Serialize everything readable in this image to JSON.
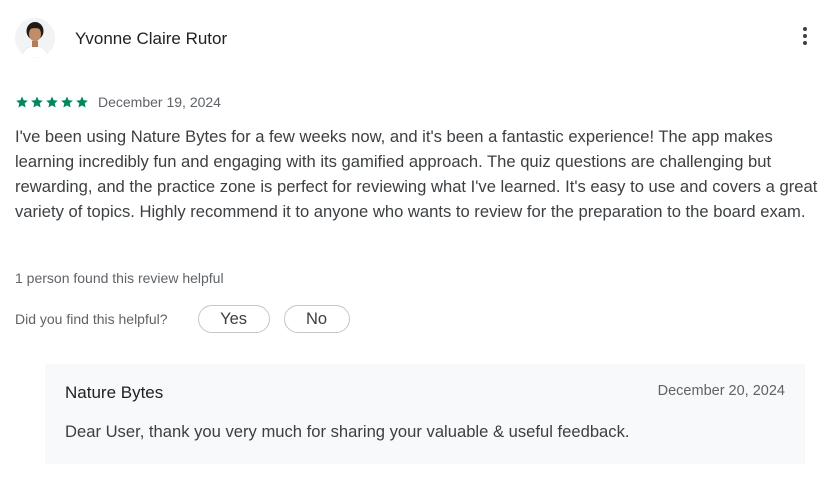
{
  "review": {
    "author": "Yvonne Claire Rutor",
    "avatar_icon": "user-avatar-photo",
    "more_icon": "more-vert-icon",
    "rating": 5,
    "rating_max": 5,
    "star_color": "#01875f",
    "date": "December 19, 2024",
    "text": "I've been using Nature Bytes for a few weeks now, and it's been a fantastic experience! The app makes learning incredibly fun and engaging with its gamified approach. The quiz questions are challenging but rewarding, and the practice zone is perfect for reviewing what I've learned. It's easy to use and covers a great variety of topics. Highly recommend it to anyone who wants to review for the preparation to the board exam.",
    "helpful_count_text": "1 person found this review helpful",
    "helpful_question": "Did you find this helpful?",
    "yes_label": "Yes",
    "no_label": "No"
  },
  "reply": {
    "author": "Nature Bytes",
    "date": "December 20, 2024",
    "text": "Dear User, thank you very much for sharing your valuable & useful feedback."
  }
}
